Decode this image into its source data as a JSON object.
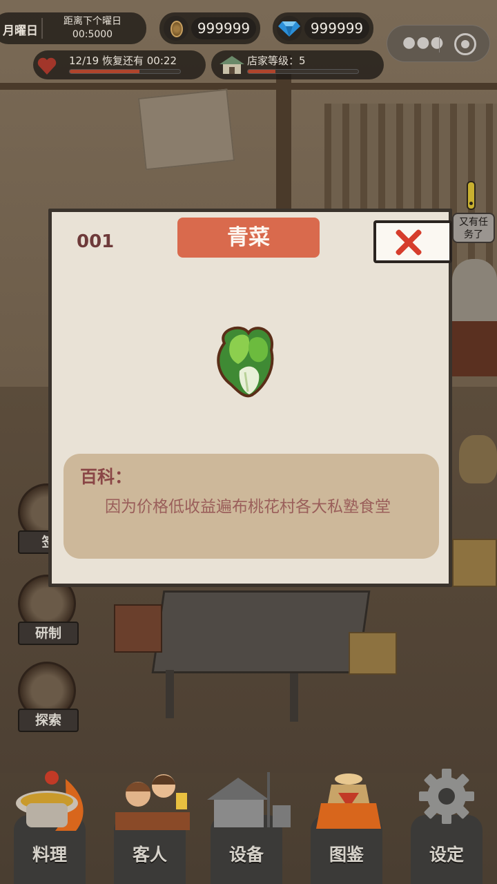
{
  "hud": {
    "day_label": "月曜日",
    "next_day_label": "距离下个曜日",
    "next_day_time": "00:5000",
    "coins": "999999",
    "gems": "999999",
    "stamina_text": "12/19 恢复还有 00:22",
    "stamina_progress": 0.63,
    "shop_level_text": "店家等级：5",
    "shop_level_progress": 0.25
  },
  "quest_bubble": {
    "text": "又有任务了"
  },
  "side_buttons": [
    {
      "label": "签",
      "icon": "sign-in-book-icon"
    },
    {
      "label": "研制",
      "icon": "recipe-book-icon"
    },
    {
      "label": "探索",
      "icon": "explore-scroll-icon"
    }
  ],
  "modal": {
    "item_number": "001",
    "item_name": "青菜",
    "item_icon": "bok-choy-icon",
    "encyclopedia_heading": "百科：",
    "description": "因为价格低收益遍布桃花村各大私塾食堂",
    "close_icon": "close-x-icon"
  },
  "nav": [
    {
      "label": "料理",
      "icon": "cooking-pot-icon"
    },
    {
      "label": "客人",
      "icon": "customers-icon"
    },
    {
      "label": "设备",
      "icon": "equipment-house-icon"
    },
    {
      "label": "图鉴",
      "icon": "encyclopedia-bag-icon"
    },
    {
      "label": "设定",
      "icon": "gear-icon"
    }
  ],
  "colors": {
    "title_badge": "#d96a4d",
    "close_x": "#d63d2c",
    "modal_bg": "#e9e2d6",
    "desc_box": "#cdb89a",
    "progress_fill": "#b0442c"
  }
}
